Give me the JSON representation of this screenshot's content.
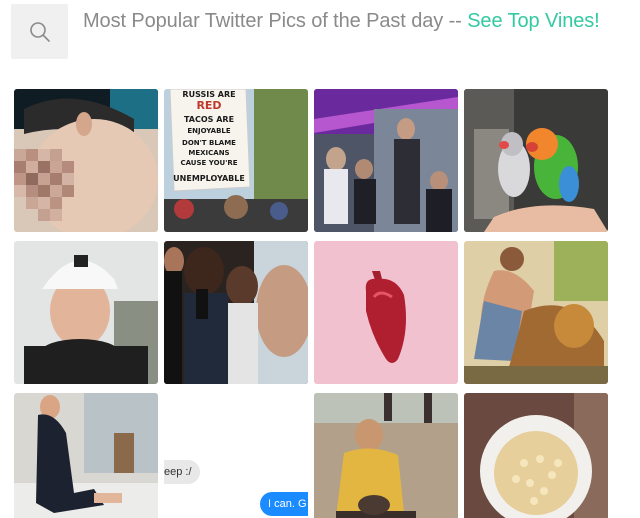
{
  "header": {
    "title": "Most Popular Twitter Pics of the Past day -- ",
    "link_label": "See Top Vines!"
  },
  "search": {
    "icon": "search-icon"
  },
  "sign_text": [
    "RUSSIS ARE",
    "RED",
    "TACOS ARE",
    "ENJOYABLE",
    "DON'T BLAME",
    "MEXICANS",
    "CAUSE YOU'RE",
    "UNEMPLOYABLE"
  ],
  "chat": {
    "grey_bubble": "eep :/",
    "blue_bubble": "I can. G"
  },
  "photos": [
    {
      "id": "pixelated-man"
    },
    {
      "id": "protest-sign"
    },
    {
      "id": "band-on-stage"
    },
    {
      "id": "lovebirds"
    },
    {
      "id": "man-in-cap"
    },
    {
      "id": "press-crowd"
    },
    {
      "id": "red-heart"
    },
    {
      "id": "hercules-lion"
    },
    {
      "id": "man-sitting"
    },
    {
      "id": "chat-screenshot"
    },
    {
      "id": "man-on-beach"
    },
    {
      "id": "bowl-of-grain"
    }
  ]
}
